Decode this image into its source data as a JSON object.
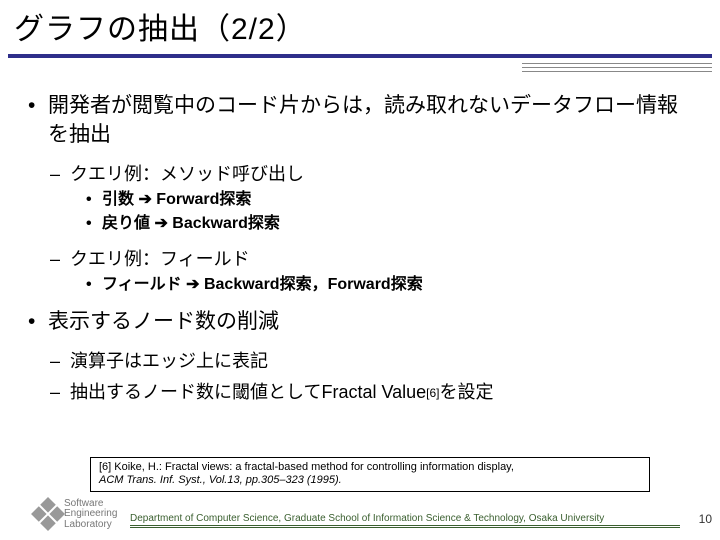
{
  "title": "グラフの抽出（2/2）",
  "b1a": "開発者が閲覧中のコード片からは，読み取れないデータフロー情報を抽出",
  "b2a": "クエリ例：メソッド呼び出し",
  "b3a": "引数  ➔   Forward探索",
  "b3b": "戻り値  ➔   Backward探索",
  "b2b": "クエリ例：フィールド",
  "b3c": "フィールド  ➔   Backward探索，Forward探索",
  "b1b": "表示するノード数の削減",
  "b2c": "演算子はエッジ上に表記",
  "b2d_pre": "抽出するノード数に閾値としてFractal Value",
  "b2d_ref": "[6]",
  "b2d_post": "を設定",
  "ref_line1": "[6] Koike, H.: Fractal views: a fractal-based method for controlling information display,",
  "ref_line2": "ACM Trans. Inf. Syst., Vol.13, pp.305–323 (1995).",
  "logo_l1": "Software",
  "logo_l2": "Engineering",
  "logo_l3": "Laboratory",
  "dept": "Department of Computer Science, Graduate School of Information Science & Technology, Osaka University",
  "page": "10"
}
